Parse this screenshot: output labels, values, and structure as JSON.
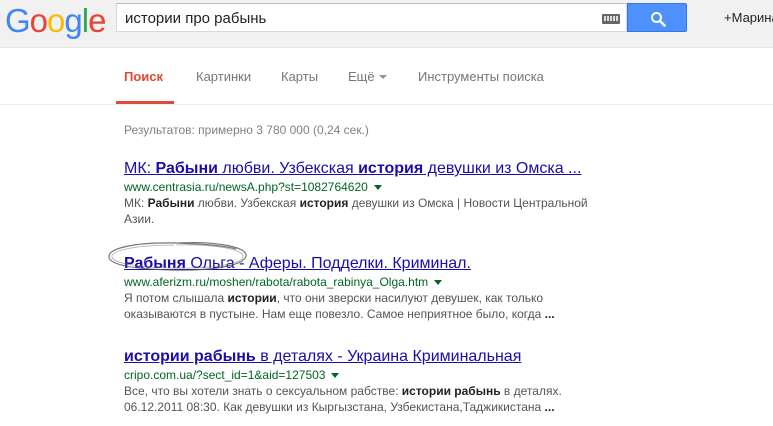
{
  "header": {
    "logo_letters": [
      {
        "ch": "G",
        "color": "#4285f4"
      },
      {
        "ch": "o",
        "color": "#ea4335"
      },
      {
        "ch": "o",
        "color": "#fbbc05"
      },
      {
        "ch": "g",
        "color": "#4285f4"
      },
      {
        "ch": "l",
        "color": "#34a853"
      },
      {
        "ch": "e",
        "color": "#ea4335"
      }
    ],
    "search_value": "истории про рабынь",
    "user_label": "+Марина"
  },
  "nav": {
    "tabs": [
      {
        "label": "Поиск",
        "active": true
      },
      {
        "label": "Картинки",
        "active": false
      },
      {
        "label": "Карты",
        "active": false
      },
      {
        "label": "Ещё",
        "active": false
      },
      {
        "label": "Инструменты поиска",
        "active": false
      }
    ]
  },
  "stats": "Результатов: примерно 3 780 000 (0,24 сек.)",
  "results": [
    {
      "title_parts": [
        {
          "t": "МК: ",
          "b": false
        },
        {
          "t": "Рабыни",
          "b": true
        },
        {
          "t": " любви. Узбекская ",
          "b": false
        },
        {
          "t": "история",
          "b": true
        },
        {
          "t": " девушки из Омска ...",
          "b": false
        }
      ],
      "url": "www.centrasia.ru/newsA.php?st=1082764620",
      "snippet_lines": [
        [
          {
            "t": "МК: ",
            "b": false
          },
          {
            "t": "Рабыни",
            "b": true
          },
          {
            "t": " любви. Узбекская ",
            "b": false
          },
          {
            "t": "история",
            "b": true
          },
          {
            "t": " девушки из Омска | Новости Центральной",
            "b": false
          }
        ],
        [
          {
            "t": "Азии.",
            "b": false
          }
        ]
      ]
    },
    {
      "title_parts": [
        {
          "t": "Рабыня",
          "b": true
        },
        {
          "t": " Ольга - Аферы. Подделки. Криминал.",
          "b": false
        }
      ],
      "url": "www.aferizm.ru/moshen/rabota/rabota_rabinya_Olga.htm",
      "snippet_lines": [
        [
          {
            "t": "Я потом слышала ",
            "b": false
          },
          {
            "t": "истории",
            "b": true
          },
          {
            "t": ", что они зверски насилуют девушек, как только",
            "b": false
          }
        ],
        [
          {
            "t": "оказываются в пустыне. Нам еще повезло. Самое неприятное было, когда ",
            "b": false
          },
          {
            "t": "...",
            "b": true
          }
        ]
      ]
    },
    {
      "title_parts": [
        {
          "t": "истории рабынь",
          "b": true
        },
        {
          "t": " в деталях - Украина Криминальная",
          "b": false
        }
      ],
      "url": "cripo.com.ua/?sect_id=1&aid=127503",
      "snippet_lines": [
        [
          {
            "t": "Все, что вы хотели знать о сексуальном рабстве: ",
            "b": false
          },
          {
            "t": "истории рабынь",
            "b": true
          },
          {
            "t": " в деталях.",
            "b": false
          }
        ],
        [
          {
            "t": "06.12.2011 08:30. Как девушки из Кыргызстана, Узбекистана,Таджикистана ",
            "b": false
          },
          {
            "t": "...",
            "b": true
          }
        ]
      ]
    }
  ]
}
